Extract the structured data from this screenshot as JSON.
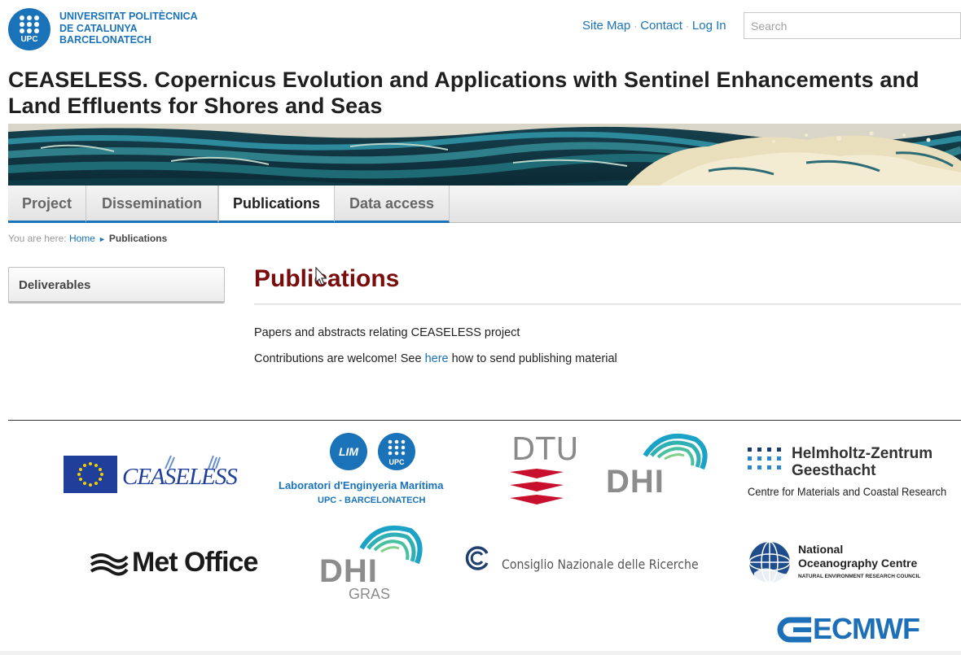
{
  "header": {
    "university_abbr": "UPC",
    "university_name_lines": [
      "UNIVERSITAT POLITÈCNICA",
      "DE CATALUNYA",
      "BARCELONATECH"
    ],
    "links": [
      "Site Map",
      "Contact",
      "Log In"
    ],
    "link_separator": "·",
    "search_placeholder": "Search"
  },
  "site_title": {
    "segments": [
      {
        "text": "CEASELESS",
        "bold": true
      },
      {
        "text": ". ",
        "bold": false
      },
      {
        "text": "C",
        "bold": true
      },
      {
        "text": "opernicus ",
        "bold": false
      },
      {
        "text": "E",
        "bold": true
      },
      {
        "text": "volution and ",
        "bold": false
      },
      {
        "text": "A",
        "bold": true
      },
      {
        "text": "pplications with ",
        "bold": false
      },
      {
        "text": "S",
        "bold": true
      },
      {
        "text": "entinel ",
        "bold": false
      },
      {
        "text": "E",
        "bold": true
      },
      {
        "text": "nhancements and ",
        "bold": false
      },
      {
        "text": "L",
        "bold": true
      },
      {
        "text": "and ",
        "bold": false
      },
      {
        "text": "E",
        "bold": true
      },
      {
        "text": "ffluents for ",
        "bold": false
      },
      {
        "text": "S",
        "bold": true
      },
      {
        "text": "hores and ",
        "bold": false
      },
      {
        "text": "S",
        "bold": true
      },
      {
        "text": "eas",
        "bold": false
      }
    ]
  },
  "nav": {
    "tabs": [
      "Project",
      "Dissemination",
      "Publications",
      "Data access"
    ],
    "active": "Publications"
  },
  "breadcrumb": {
    "prefix": "You are here:",
    "home": "Home",
    "arrow": "►",
    "current": "Publications"
  },
  "sidebar": {
    "items": [
      "Deliverables"
    ]
  },
  "main": {
    "title": "Publications",
    "paragraph1": "Papers and abstracts relating CEASELESS project",
    "paragraph2_before": "Contributions are welcome! See ",
    "paragraph2_link": "here",
    "paragraph2_after": " how to send publishing material"
  },
  "partners": {
    "ceaseless": "CEASELESS",
    "lim_badge": "LIM",
    "lim_upc_badge": "UPC",
    "lim_name": "Laboratori d'Enginyeria Marítima",
    "lim_sub": "UPC - BARCELONATECH",
    "dtu": "DTU",
    "dhi": "DHI",
    "hzg_line1": "Helmholtz-Zentrum",
    "hzg_line2": "Geesthacht",
    "hzg_line3": "Centre for Materials and Coastal Research",
    "metoffice": "Met Office",
    "dhi_gras_top": "DHI",
    "dhi_gras_bottom": "GRAS",
    "cnr": "Consiglio Nazionale delle Ricerche",
    "noc_line1": "National",
    "noc_line2": "Oceanography Centre",
    "noc_line3": "NATURAL ENVIRONMENT RESEARCH COUNCIL",
    "ecmwf": "ECMWF"
  },
  "colors": {
    "link_blue": "#1a73b8",
    "title_red": "#7a0c0c",
    "eu_blue": "#1f3f9a",
    "eu_gold": "#f5d000",
    "dtu_red": "#c8102e",
    "dhi_teal": "#1aa2c7",
    "ecmwf_blue": "#1d70b7"
  }
}
